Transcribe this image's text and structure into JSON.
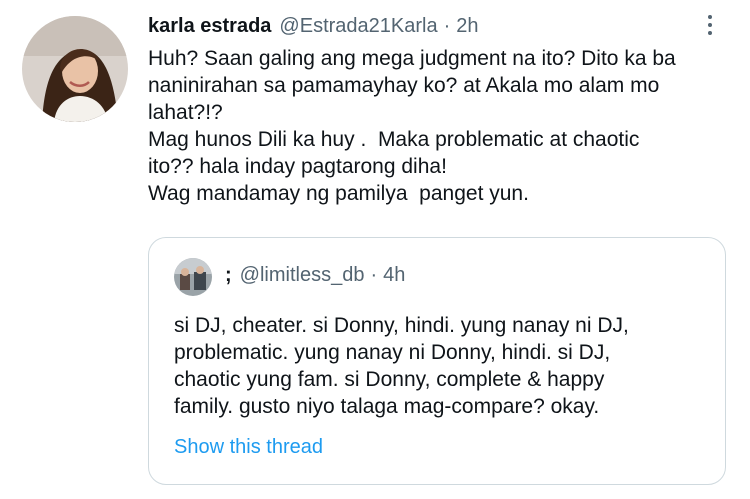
{
  "tweet": {
    "display_name": "karla estrada",
    "handle": "@Estrada21Karla",
    "separator": "·",
    "time": "2h",
    "more_icon": "more-vertical-icon",
    "lines": [
      "Huh? Saan galing ang mega judgment na ito? Dito ka ba",
      "naninirahan sa pamamayhay ko? at Akala mo alam mo",
      "lahat?!?",
      "Mag hunos Dili ka huy .  Maka problematic at chaotic",
      "ito?? hala inday pagtarong diha!",
      "Wag mandamay ng pamilya  panget yun."
    ]
  },
  "quoted": {
    "display_name": ";",
    "handle": "@limitless_db",
    "separator": "·",
    "time": "4h",
    "lines": [
      "si DJ, cheater. si Donny, hindi. yung nanay ni DJ,",
      "problematic. yung nanay ni Donny, hindi. si DJ,",
      "chaotic yung fam. si Donny, complete & happy",
      "family. gusto niyo talaga mag-compare? okay."
    ],
    "show_thread": "Show this thread"
  },
  "colors": {
    "text": "#0f1419",
    "muted": "#536471",
    "link": "#1d9bf0",
    "border": "#cfd9de"
  }
}
